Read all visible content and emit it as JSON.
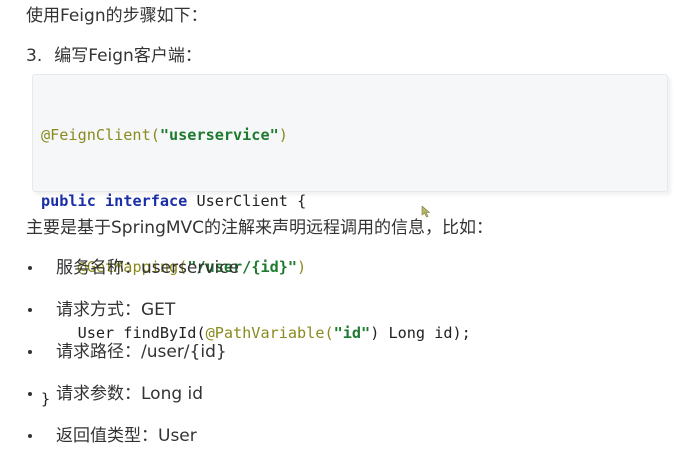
{
  "intro": "使用Feign的步骤如下：",
  "step": {
    "number": "3.",
    "text": "编写Feign客户端："
  },
  "code": {
    "line1": {
      "annotation": "@FeignClient(",
      "string": "\"userservice\"",
      "close": ")"
    },
    "line2": {
      "kw1": "public",
      "kw2": "interface",
      "rest": "UserClient {"
    },
    "line3": {
      "indent": "    ",
      "annotation": "@GetMapping(",
      "string": "\"/user/{id}\"",
      "close": ")"
    },
    "line4": {
      "indent": "    ",
      "prefix": "User findById(",
      "annotation": "@PathVariable(",
      "string": "\"id\"",
      "suffix": ") Long id);"
    },
    "line5": "}"
  },
  "summary": "主要是基于SpringMVC的注解来声明远程调用的信息，比如：",
  "bullets": [
    "服务名称：userservice",
    "请求方式：GET",
    "请求路径：/user/{id}",
    "请求参数：Long id",
    "返回值类型：User"
  ],
  "colors": {
    "annotation": "#8a8a1e",
    "string": "#1e7a2e",
    "keyword": "#1a2ea8",
    "code_background": "#f6f7f9",
    "text": "#333333"
  },
  "icons": {
    "cursor": "mouse-pointer-icon"
  }
}
